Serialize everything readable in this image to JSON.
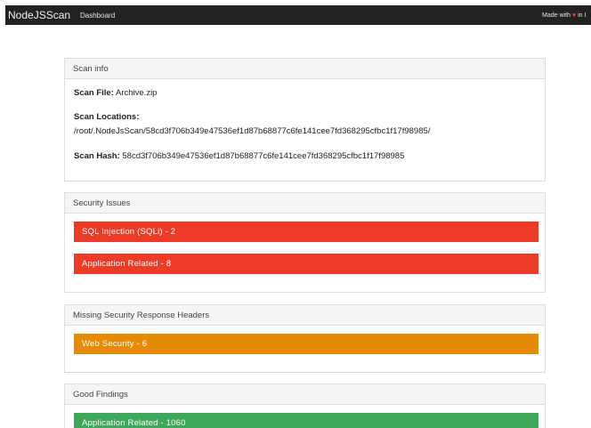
{
  "navbar": {
    "brand": "NodeJSScan",
    "dashboard": "Dashboard",
    "made_with": "Made with",
    "heart": "♥",
    "in_text": "in I"
  },
  "scan_info": {
    "title": "Scan info",
    "file_label": "Scan File:",
    "file_value": "Archive.zip",
    "locations_label": "Scan Locations:",
    "locations_value": "/root/.NodeJsScan/58cd3f706b349e47536ef1d87b68877c6fe141cee7fd368295cfbc1f17f98985/",
    "hash_label": "Scan Hash:",
    "hash_value": "58cd3f706b349e47536ef1d87b68877c6fe141cee7fd368295cfbc1f17f98985"
  },
  "security_issues": {
    "title": "Security Issues",
    "items": [
      "SQL Injection (SQLi) - 2",
      "Application Related - 8"
    ]
  },
  "missing_headers": {
    "title": "Missing Security Response Headers",
    "items": [
      "Web Security - 6"
    ]
  },
  "good_findings": {
    "title": "Good Findings",
    "items": [
      "Application Related - 1060"
    ]
  },
  "colors": {
    "navbar": "#222222",
    "danger": "#ed3b27",
    "warning": "#e78a03",
    "success": "#3da85a"
  }
}
